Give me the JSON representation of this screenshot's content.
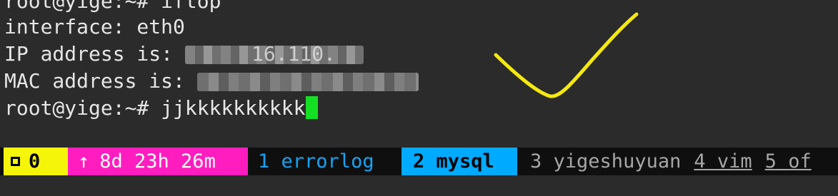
{
  "terminal": {
    "lines": {
      "cmd_partial": "root@yige:~# iftop",
      "interface": "interface: eth0",
      "ip_label": "IP address is: ",
      "ip_visible_fragment": "16.110.",
      "mac_label": "MAC address is: ",
      "prompt": "root@yige:~# ",
      "typed_input": "jjkkkkkkkkkk"
    },
    "colors": {
      "background": "#2b2b2b",
      "foreground": "#e6e6e6",
      "cursor": "#13e023",
      "checkmark": "#f5e90f"
    }
  },
  "statusbar": {
    "session": {
      "icon": "square-icon",
      "count": "0"
    },
    "uptime": {
      "arrow": "↑",
      "text": "8d 23h 26m"
    },
    "windows": [
      {
        "index": "1",
        "name": "errorlog"
      },
      {
        "index": "2",
        "name": "mysql",
        "active": true
      },
      {
        "index": "3",
        "name": "yigeshuyuan"
      },
      {
        "index": "4",
        "name": "vim"
      },
      {
        "index": "5",
        "name": "of"
      }
    ],
    "colors": {
      "session_bg": "#f5f50a",
      "uptime_bg": "#ff1dbf",
      "active_bg": "#00aaff",
      "window1": "#16a3f2",
      "inactive": "#a6a6a6"
    }
  }
}
